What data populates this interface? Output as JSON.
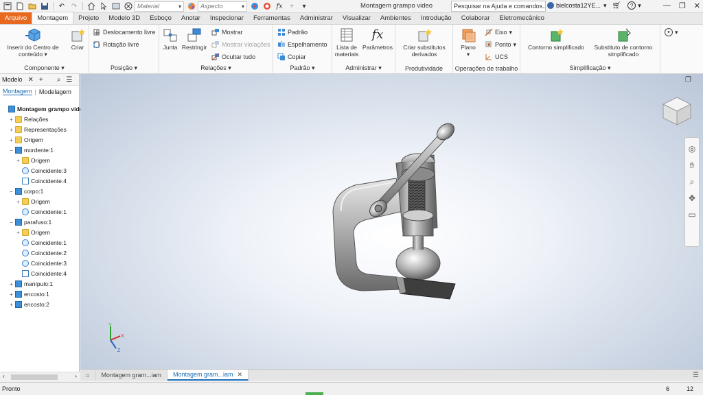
{
  "titlebar": {
    "material_placeholder": "Material",
    "appearance_placeholder": "Aspecto",
    "doc_title": "Montagem grampo video",
    "search_text": "Pesquisar na Ajuda e comandos...",
    "user_name": "bielcosta12YE..."
  },
  "tabs": [
    "Arquivo",
    "Montagem",
    "Projeto",
    "Modelo 3D",
    "Esboço",
    "Anotar",
    "Inspecionar",
    "Ferramentas",
    "Administrar",
    "Visualizar",
    "Ambientes",
    "Introdução",
    "Colaborar",
    "Eletromecânico"
  ],
  "ribbon": {
    "componente": {
      "title": "Componente",
      "inserir": "Inserir do Centro de conteúdo",
      "criar": "Criar"
    },
    "posicao": {
      "title": "Posição",
      "deslocamento": "Deslocamento livre",
      "rotacao": "Rotação livre"
    },
    "relacoes": {
      "title": "Relações",
      "junta": "Junta",
      "restringir": "Restringir",
      "mostrar": "Mostrar",
      "mostrar_violacoes": "Mostrar violações",
      "ocultar_tudo": "Ocultar tudo"
    },
    "padrao": {
      "title": "Padrão",
      "padrao": "Padrão",
      "espelhamento": "Espelhamento",
      "copiar": "Copiar"
    },
    "administrar": {
      "title": "Administrar",
      "lista": "Lista de materiais",
      "parametros": "Parâmetros"
    },
    "produtividade": {
      "title": "Produtividade",
      "criar_substitutos": "Criar substitutos derivados"
    },
    "operacoes": {
      "title": "Operações de trabalho",
      "plano": "Plano",
      "eixo": "Eixo",
      "ponto": "Ponto",
      "ucs": "UCS"
    },
    "simplificacao": {
      "title": "Simplificação",
      "contorno": "Contorno simplificado",
      "substituto": "Substituto de contorno simplificado"
    }
  },
  "browser": {
    "header": "Modelo",
    "tab_montagem": "Montagem",
    "tab_modelagem": "Modelagem",
    "tree": [
      {
        "label": "Montagem grampo video",
        "depth": 0,
        "icon": "assembly",
        "exp": "",
        "bold": true
      },
      {
        "label": "Relações",
        "depth": 1,
        "icon": "folder",
        "exp": "+"
      },
      {
        "label": "Representações",
        "depth": 1,
        "icon": "repr",
        "exp": "+"
      },
      {
        "label": "Origem",
        "depth": 1,
        "icon": "folder",
        "exp": "+"
      },
      {
        "label": "mordente:1",
        "depth": 1,
        "icon": "part",
        "exp": "−"
      },
      {
        "label": "Origem",
        "depth": 2,
        "icon": "folder",
        "exp": "+"
      },
      {
        "label": "Coincidente:3",
        "depth": 2,
        "icon": "constraint",
        "exp": ""
      },
      {
        "label": "Coincidente:4",
        "depth": 2,
        "icon": "constraint2",
        "exp": ""
      },
      {
        "label": "corpo:1",
        "depth": 1,
        "icon": "part-grounded",
        "exp": "−"
      },
      {
        "label": "Origem",
        "depth": 2,
        "icon": "folder",
        "exp": "+"
      },
      {
        "label": "Coincidente:1",
        "depth": 2,
        "icon": "constraint",
        "exp": ""
      },
      {
        "label": "parafuso:1",
        "depth": 1,
        "icon": "part",
        "exp": "−"
      },
      {
        "label": "Origem",
        "depth": 2,
        "icon": "folder",
        "exp": "+"
      },
      {
        "label": "Coincidente:1",
        "depth": 2,
        "icon": "constraint",
        "exp": ""
      },
      {
        "label": "Coincidente:2",
        "depth": 2,
        "icon": "constraint",
        "exp": ""
      },
      {
        "label": "Coincidente:3",
        "depth": 2,
        "icon": "constraint",
        "exp": ""
      },
      {
        "label": "Coincidente:4",
        "depth": 2,
        "icon": "constraint2",
        "exp": ""
      },
      {
        "label": "manípulo:1",
        "depth": 1,
        "icon": "part",
        "exp": "+"
      },
      {
        "label": "encosto:1",
        "depth": 1,
        "icon": "part",
        "exp": "+"
      },
      {
        "label": "encosto:2",
        "depth": 1,
        "icon": "part",
        "exp": "+"
      }
    ]
  },
  "triad": {
    "x": "X",
    "y": "Y",
    "z": "Z"
  },
  "doc_tabs": [
    {
      "label": "Montagem gram...iam",
      "active": false
    },
    {
      "label": "Montagem gram...iam",
      "active": true
    }
  ],
  "status": {
    "text": "Pronto",
    "count1": "6",
    "count2": "12"
  },
  "colors": {
    "file_tab": "#e8691e",
    "accent": "#1b6fb8"
  }
}
